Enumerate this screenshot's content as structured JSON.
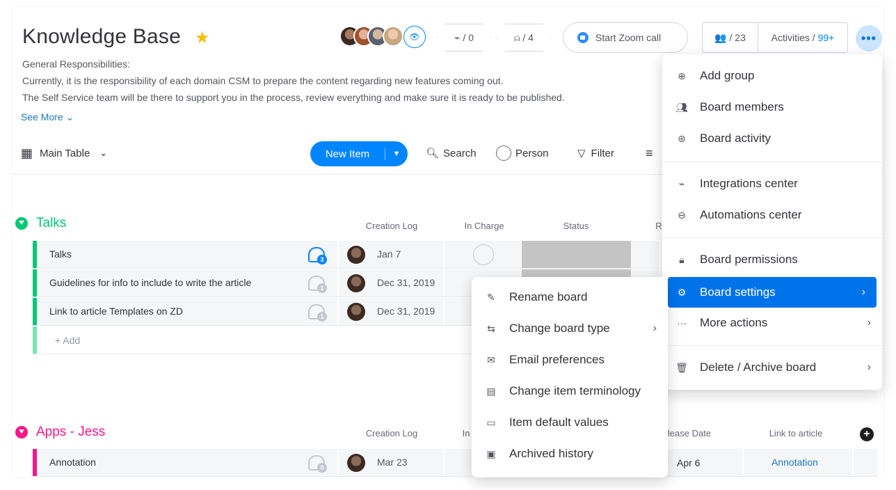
{
  "header": {
    "title": "Knowledge Base",
    "description": [
      "General Responsibilities:",
      "Currently, it is the responsibility of each domain CSM to prepare the content regarding new features coming out.",
      "The Self Service team will be there to support you in the process, review everything and make sure it is ready to be published."
    ],
    "see_more": "See More",
    "integrations_count": "/ 0",
    "automations_count": "/ 4",
    "zoom_label": "Start Zoom call",
    "members_count": "/ 23",
    "activities_label": "Activities /",
    "activities_count": "99+"
  },
  "toolbar": {
    "view_label": "Main Table",
    "new_item_label": "New Item",
    "search_label": "Search",
    "person_label": "Person",
    "filter_label": "Filter"
  },
  "groups": [
    {
      "title": "Talks",
      "color": "#00c875",
      "columns": [
        "Creation Log",
        "In Charge",
        "Status",
        "R"
      ],
      "rows": [
        {
          "name": "Talks",
          "updates": "3",
          "date": "Jan 7"
        },
        {
          "name": "Guidelines for info to include to write the article",
          "updates": "1",
          "date": "Dec 31, 2019"
        },
        {
          "name": "Link to article Templates on ZD",
          "updates": "1",
          "date": "Dec 31, 2019"
        }
      ],
      "add_label": "+ Add"
    },
    {
      "title": "Apps - Jess",
      "color": "#ff158a",
      "columns": [
        "Creation Log",
        "In",
        "lease Date",
        "Link to article"
      ],
      "rows": [
        {
          "name": "Annotation",
          "updates": "0",
          "date": "Mar 23",
          "release_date": "Apr 6",
          "link": "Annotation"
        }
      ]
    }
  ],
  "board_menu": {
    "items": [
      {
        "label": "Add group",
        "icon": "plus-circle-icon"
      },
      {
        "label": "Board members",
        "icon": "members-icon"
      },
      {
        "label": "Board activity",
        "icon": "activity-icon"
      },
      {
        "label": "Integrations center",
        "icon": "plug-icon"
      },
      {
        "label": "Automations center",
        "icon": "robot-icon"
      },
      {
        "label": "Board permissions",
        "icon": "lock-icon"
      },
      {
        "label": "Board settings",
        "icon": "gear-icon"
      },
      {
        "label": "More actions",
        "icon": "dots-icon"
      },
      {
        "label": "Delete / Archive board",
        "icon": "trash-icon"
      }
    ]
  },
  "settings_submenu": {
    "items": [
      {
        "label": "Rename board",
        "icon": "pencil-icon"
      },
      {
        "label": "Change board type",
        "icon": "swap-icon"
      },
      {
        "label": "Email preferences",
        "icon": "envelope-icon"
      },
      {
        "label": "Change item terminology",
        "icon": "id-card-icon"
      },
      {
        "label": "Item default values",
        "icon": "text-field-icon"
      },
      {
        "label": "Archived history",
        "icon": "archive-icon"
      }
    ]
  },
  "colors": {
    "accent": "#0085ff",
    "active_menu": "#0073ea",
    "talks_group": "#00c875",
    "apps_group": "#ff158a",
    "star": "#fdbc00"
  }
}
